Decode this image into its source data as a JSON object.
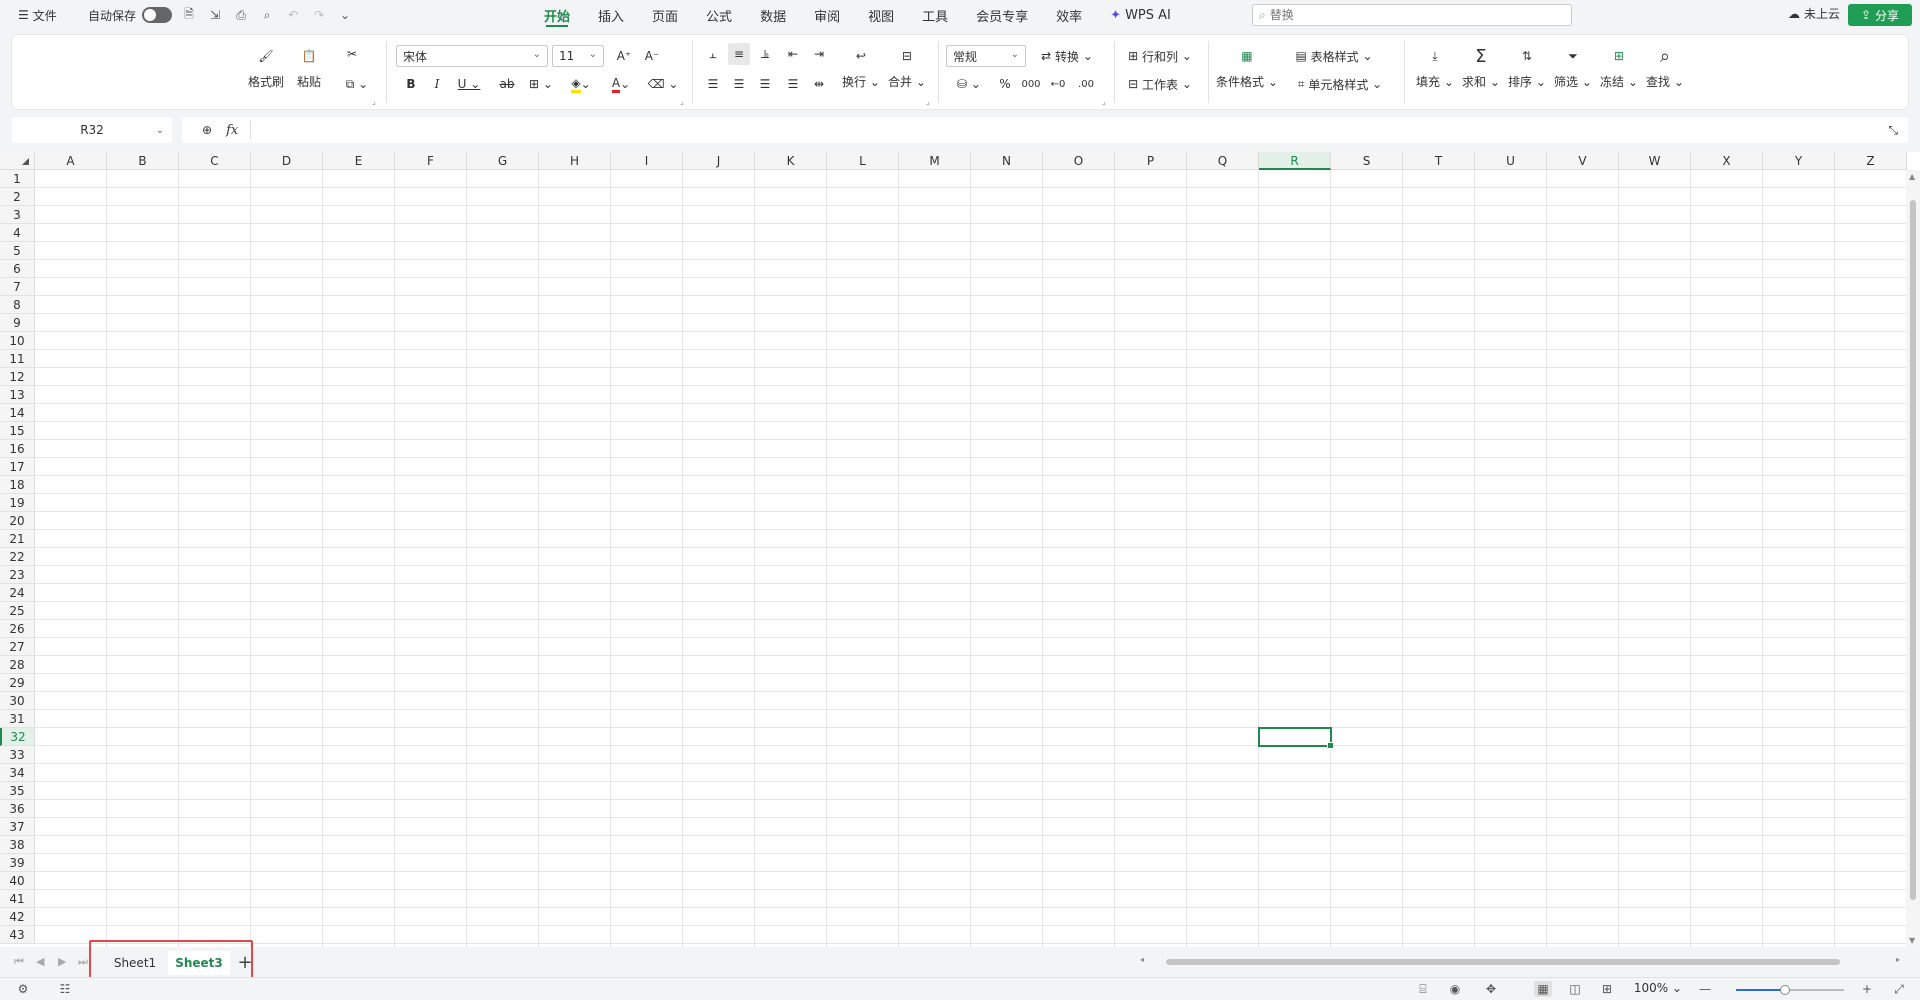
{
  "topbar": {
    "file_label": "文件",
    "autosave_label": "自动保存",
    "tabs": [
      "开始",
      "插入",
      "页面",
      "公式",
      "数据",
      "审阅",
      "视图",
      "工具",
      "会员专享",
      "效率"
    ],
    "active_tab": "开始",
    "wps_ai_label": "WPS AI",
    "search_placeholder": "替换",
    "cloud_label": "未上云",
    "share_label": "分享"
  },
  "ribbon": {
    "format_painter": "格式刷",
    "paste": "粘贴",
    "font_name": "宋体",
    "font_size": "11",
    "wrap": "换行",
    "merge": "合并",
    "number_format": "常规",
    "convert": "转换",
    "row_col": "行和列",
    "worksheet": "工作表",
    "cond_format": "条件格式",
    "table_style": "表格样式",
    "cell_style": "单元格样式",
    "fill": "填充",
    "sum": "求和",
    "sort": "排序",
    "filter": "筛选",
    "freeze": "冻结",
    "find": "查找"
  },
  "formula_bar": {
    "name_box": "R32",
    "fx": "fx",
    "value": ""
  },
  "grid": {
    "columns": [
      "A",
      "B",
      "C",
      "D",
      "E",
      "F",
      "G",
      "H",
      "I",
      "J",
      "K",
      "L",
      "M",
      "N",
      "O",
      "P",
      "Q",
      "R",
      "S",
      "T",
      "U",
      "V",
      "W",
      "X",
      "Y",
      "Z"
    ],
    "rows": [
      "1",
      "2",
      "3",
      "4",
      "5",
      "6",
      "7",
      "8",
      "9",
      "10",
      "11",
      "12",
      "13",
      "14",
      "15",
      "16",
      "17",
      "18",
      "19",
      "20",
      "21",
      "22",
      "23",
      "24",
      "25",
      "26",
      "27",
      "28",
      "29",
      "30",
      "31",
      "32",
      "33",
      "34",
      "35",
      "36",
      "37",
      "38",
      "39",
      "40",
      "41",
      "42",
      "43"
    ],
    "selected_column": "R",
    "selected_row": "32"
  },
  "sheets": {
    "tabs": [
      "Sheet1",
      "Sheet3"
    ],
    "active": "Sheet3",
    "add_label": "+"
  },
  "status": {
    "zoom": "100%",
    "zoom_level": 0.45
  },
  "colors": {
    "accent": "#1f8a4c",
    "share": "#1f9d55",
    "highlight": "#e24848"
  }
}
